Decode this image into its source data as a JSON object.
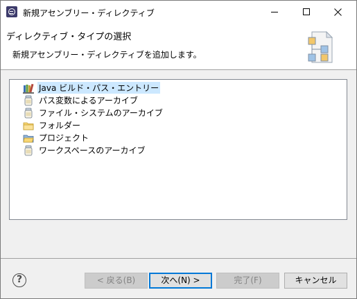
{
  "window": {
    "title": "新規アセンブリー・ディレクティブ"
  },
  "banner": {
    "title": "ディレクティブ・タイプの選択",
    "description": "新規アセンブリー・ディレクティブを追加します。"
  },
  "tree": {
    "items": [
      {
        "label": "Java ビルド・パス・エントリー",
        "icon": "library-icon",
        "selected": true
      },
      {
        "label": "パス変数によるアーカイブ",
        "icon": "jar-icon",
        "selected": false
      },
      {
        "label": "ファイル・システムのアーカイブ",
        "icon": "jar-icon",
        "selected": false
      },
      {
        "label": "フォルダー",
        "icon": "folder-icon",
        "selected": false
      },
      {
        "label": "プロジェクト",
        "icon": "project-icon",
        "selected": false
      },
      {
        "label": "ワークスペースのアーカイブ",
        "icon": "jar-icon",
        "selected": false
      }
    ]
  },
  "footer": {
    "help": "?",
    "back_label": "< 戻る(B)",
    "next_label": "次へ(N) >",
    "finish_label": "完了(F)",
    "cancel_label": "キャンセル"
  },
  "colors": {
    "selection": "#cce8ff",
    "default_button_border": "#0078d7",
    "dialog_background": "#f0f0f0"
  }
}
